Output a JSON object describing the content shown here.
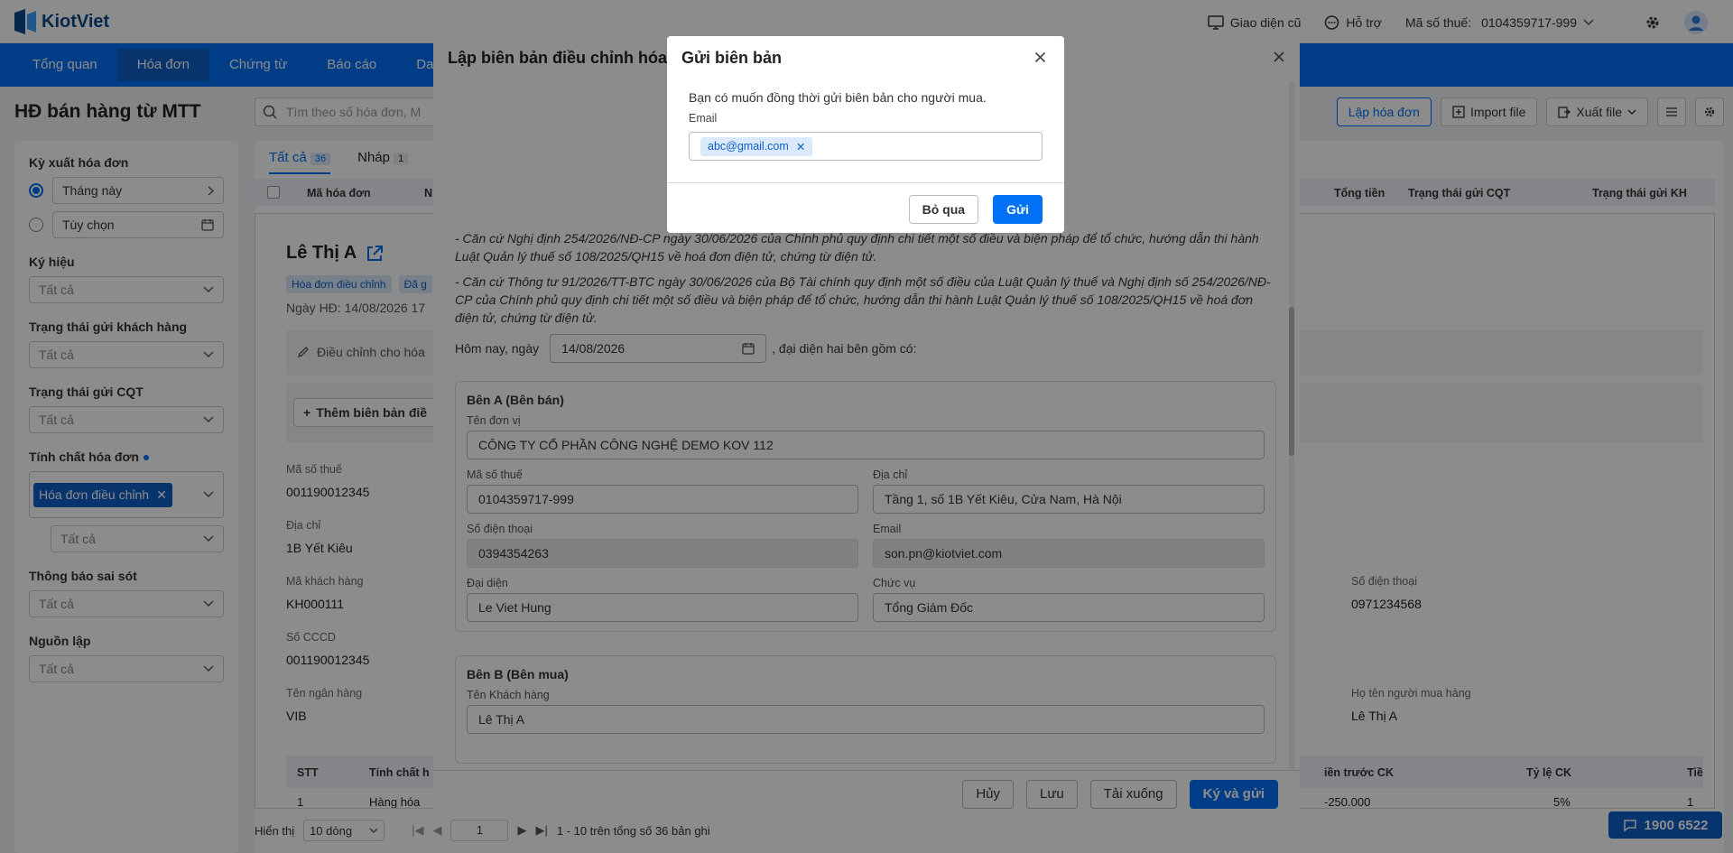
{
  "app": {
    "name": "KiotViet"
  },
  "topbar": {
    "old_ui": "Giao diện cũ",
    "support": "Hỗ trợ",
    "tax_label": "Mã số thuế:",
    "tax_value": "0104359717-999"
  },
  "nav": [
    "Tổng quan",
    "Hóa đơn",
    "Chứng từ",
    "Báo cáo",
    "Danh"
  ],
  "page": {
    "title": "HĐ bán hàng từ MTT",
    "search_placeholder": "Tìm theo số hóa đơn, M",
    "create_label": "Lập hóa đơn",
    "import_label": "Import file",
    "export_label": "Xuất file"
  },
  "filters": {
    "period_label": "Kỳ xuất hóa đơn",
    "period_this_month": "Tháng này",
    "period_custom": "Tùy chọn",
    "symbol_label": "Ký hiệu",
    "symbol_value": "Tất cả",
    "customer_status_label": "Trạng thái gửi khách hàng",
    "customer_status_value": "Tất cả",
    "cqt_status_label": "Trạng thái gửi CQT",
    "cqt_status_value": "Tất cả",
    "nature_label": "Tính chất hóa đơn",
    "nature_tag": "Hóa đơn điều chỉnh",
    "nature_sub_value": "Tất cả",
    "error_label": "Thông báo sai sót",
    "error_value": "Tất cả",
    "source_label": "Nguồn lập",
    "source_value": "Tất cả"
  },
  "tabs": [
    {
      "label": "Tất cả",
      "count": "36"
    },
    {
      "label": "Nháp",
      "count": "1"
    }
  ],
  "table": {
    "col_code": "Mã hóa đơn",
    "col_n": "N",
    "col_total": "Tổng tiền",
    "col_cqt": "Trạng thái gửi CQT",
    "col_kh": "Trạng thái gửi KH"
  },
  "detail": {
    "name": "Lê Thị A",
    "tag1": "Hóa đơn điều chỉnh",
    "tag2": "Đã g",
    "date_text": "Ngày HĐ: 14/08/2026 17",
    "adjust_text": "Điều chỉnh cho hóa",
    "add_text": "Thêm biên bản điề",
    "tax_label": "Mã số thuế",
    "tax_value": "001190012345",
    "addr_label": "Địa chỉ",
    "addr_value": "1B Yết Kiêu",
    "cust_label": "Mã khách hàng",
    "cust_value": "KH000111",
    "cccd_label": "Số CCCD",
    "cccd_value": "001190012345",
    "bank_label": "Tên ngân hàng",
    "bank_value": "VIB",
    "phone_label": "Số điện thoại",
    "phone_value": "0971234568",
    "buyer_label": "Họ tên người mua hàng",
    "buyer_value": "Lê Thị A",
    "col_stt": "STT",
    "col_tc": "Tính chất h",
    "col_before": "iền trước CK",
    "col_rate": "Tỷ lệ CK",
    "col_tie": "Tiề",
    "row_no": "1",
    "row_name": "Hàng hóa",
    "row_before": "-250.000",
    "row_rate": "5%",
    "row_last": "1"
  },
  "pagination": {
    "show_label": "Hiển thị",
    "per_page": "10 dòng",
    "page": "1",
    "summary": "1 - 10 trên tổng số 36 bản ghi"
  },
  "hotline": "1900 6522",
  "modal": {
    "title": "Lập biên bản điều chỉnh hóa",
    "legal1": "- Căn cứ Nghị định 254/2026/NĐ-CP ngày 30/06/2026 của Chính phủ quy định chi tiết một số điều và biện pháp để tổ chức, hướng dẫn thi hành Luật Quản lý thuế số 108/2025/QH15 về hoá đơn điện tử, chứng từ điện tử.",
    "legal2": "- Căn cứ Thông tư 91/2026/TT-BTC ngày 30/06/2026 của Bộ Tài chính quy định một số điều của Luật Quản lý thuế và Nghị định số 254/2026/NĐ-CP của Chính phủ quy định chi tiết một số điều và biện pháp để tổ chức, hướng dẫn thi hành Luật Quản lý thuế số 108/2025/QH15 về hoá đơn điện tử, chứng từ điện tử.",
    "today_label": "Hôm nay, ngày",
    "today_value": "14/08/2026",
    "rep_text": ", đại diện hai bên gồm có:",
    "partyA": {
      "title": "Bên A (Bên bán)",
      "unit_label": "Tên đơn vị",
      "unit_value": "CÔNG TY CỔ PHẦN CÔNG NGHỆ DEMO KOV 112",
      "tax_label": "Mã số thuế",
      "tax_value": "0104359717-999",
      "addr_label": "Địa chỉ",
      "addr_value": "Tầng 1, số 1B Yết Kiêu, Cửa Nam, Hà Nội",
      "phone_label": "Số điện thoại",
      "phone_value": "0394354263",
      "email_label": "Email",
      "email_value": "son.pn@kiotviet.com",
      "rep_label": "Đại diện",
      "rep_value": "Le Viet Hung",
      "pos_label": "Chức vụ",
      "pos_value": "Tổng Giám Đốc"
    },
    "partyB": {
      "title": "Bên B (Bên mua)",
      "cust_label": "Tên Khách hàng",
      "cust_value": "Lê Thị A"
    },
    "cancel": "Hủy",
    "save": "Lưu",
    "download": "Tải xuống",
    "sign_send": "Ký và gửi"
  },
  "dialog": {
    "title": "Gửi biên bản",
    "message": "Bạn có muốn đồng thời gửi biên bản cho người mua.",
    "email_label": "Email",
    "email_chip": "abc@gmail.com",
    "skip": "Bỏ qua",
    "send": "Gửi"
  },
  "colors": {
    "primary": "#0070f4",
    "nav": "#0070f4",
    "tag_blue": "#0d5fc7",
    "overlay": "rgba(0,0,0,0.45)"
  }
}
